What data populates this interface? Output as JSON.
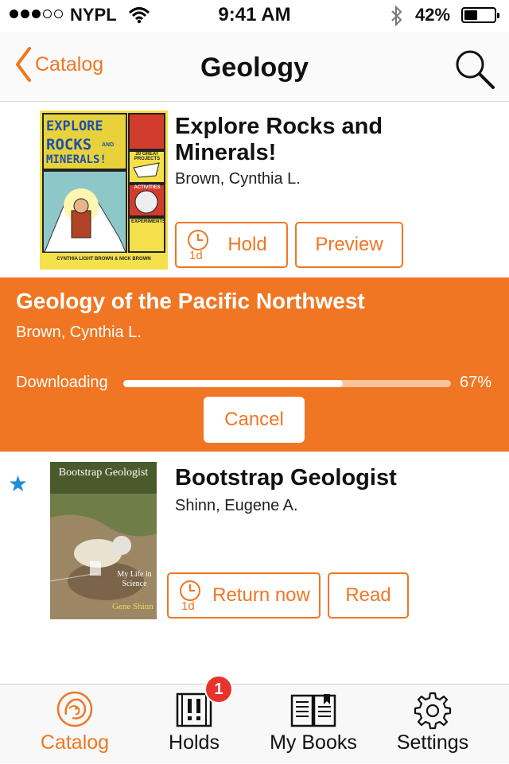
{
  "status_bar": {
    "carrier": "NYPL",
    "time": "9:41 AM",
    "battery": "42%",
    "signal_bars_filled": 3,
    "signal_bars_total": 5,
    "battery_level": 0.42
  },
  "nav": {
    "back_label": "Catalog",
    "title": "Geology",
    "back_icon": "chevron-left-icon",
    "search_icon": "search-icon"
  },
  "books": [
    {
      "title": "Explore Rocks and Minerals!",
      "author": "Brown, Cynthia L.",
      "cover_text": {
        "line1": "EXPLORE",
        "line2": "ROCKS",
        "and": "AND",
        "line3": "MINERALS!",
        "side1": "20 GREAT PROJECTS",
        "side2": "ACTIVITIES",
        "side3": "EXPERIMENTS",
        "byline": "CYNTHIA LIGHT BROWN & NICK BROWN"
      },
      "buttons": [
        {
          "label": "Hold",
          "icon": "clock-icon",
          "icon_note": "1d"
        },
        {
          "label": "Preview"
        }
      ]
    },
    {
      "title": "Bootstrap Geologist",
      "author": "Shinn, Eugene A.",
      "starred": true,
      "cover_text": {
        "title": "Bootstrap Geologist",
        "subtitle": "My Life in Science",
        "author": "Gene Shinn"
      },
      "buttons": [
        {
          "label": "Return now",
          "icon": "clock-icon",
          "icon_note": "1d"
        },
        {
          "label": "Read"
        }
      ]
    }
  ],
  "downloading": {
    "title": "Geology of the Pacific Northwest",
    "author": "Brown, Cynthia L.",
    "status": "Downloading",
    "progress": 0.67,
    "progress_label": "67%",
    "cancel_label": "Cancel"
  },
  "tabs": [
    {
      "label": "Catalog",
      "icon": "lion-logo-icon",
      "active": true
    },
    {
      "label": "Holds",
      "icon": "holds-icon",
      "badge": "1"
    },
    {
      "label": "My Books",
      "icon": "open-book-icon"
    },
    {
      "label": "Settings",
      "icon": "gear-icon"
    }
  ],
  "colors": {
    "accent": "#f07623",
    "star": "#1a8fd6",
    "badge": "#e8322c"
  }
}
